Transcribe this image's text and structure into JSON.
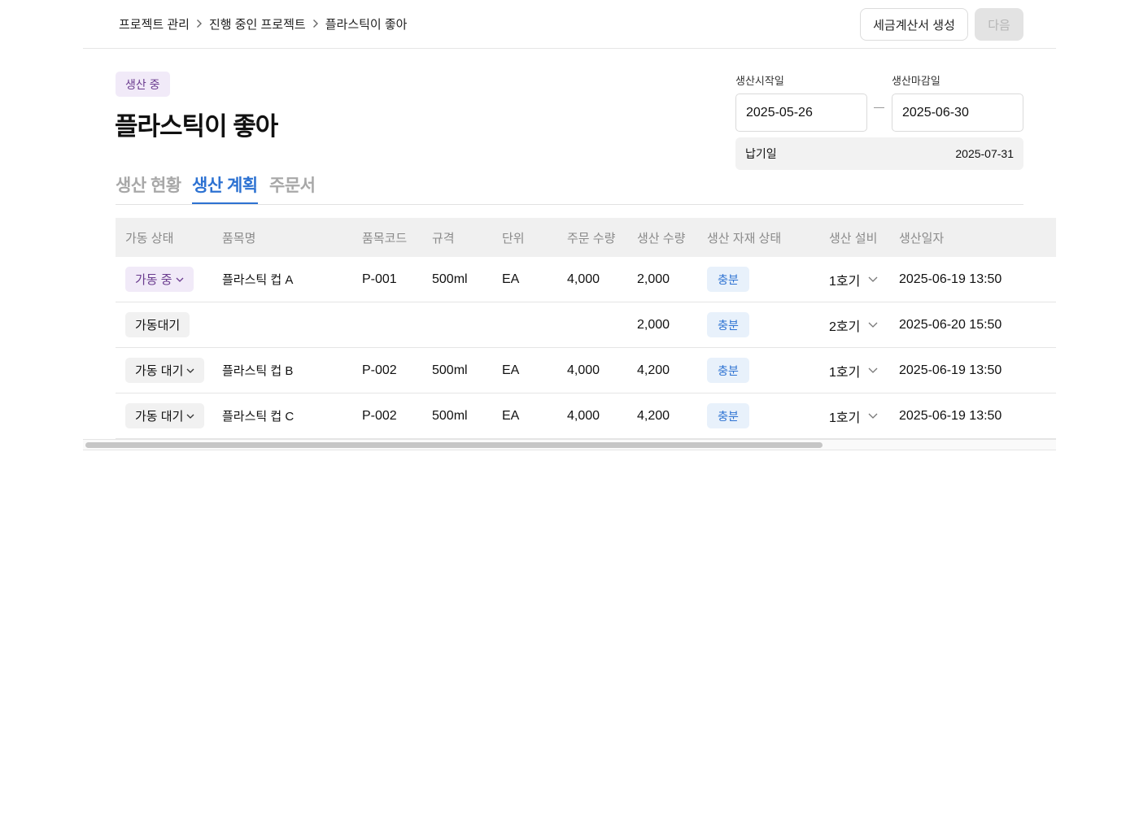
{
  "breadcrumb": [
    {
      "label": "프로젝트 관리"
    },
    {
      "label": "진행 중인 프로젝트"
    },
    {
      "label": "플라스틱이 좋아"
    }
  ],
  "header": {
    "invoice_button": "세금계산서 생성",
    "next_button": "다음"
  },
  "project": {
    "status": "생산 중",
    "title": "플라스틱이 좋아"
  },
  "tabs": [
    {
      "label": "생산 현황",
      "active": false
    },
    {
      "label": "생산 계획",
      "active": true
    },
    {
      "label": "주문서",
      "active": false
    }
  ],
  "dates": {
    "start_label": "생산시작일",
    "start_value": "2025-05-26",
    "end_label": "생산마감일",
    "end_value": "2025-06-30",
    "due_label": "납기일",
    "due_value": "2025-07-31"
  },
  "table": {
    "columns": [
      "가동 상태",
      "품목명",
      "품목코드",
      "규격",
      "단위",
      "주문 수량",
      "생산 수량",
      "생산 자재 상태",
      "생산 설비",
      "생산일자"
    ],
    "rows": [
      {
        "status": "가동 중",
        "status_type": "running",
        "has_dropdown": true,
        "name": "플라스틱 컵 A",
        "code": "P-001",
        "spec": "500ml",
        "unit": "EA",
        "order_qty": "4,000",
        "prod_qty": "2,000",
        "material": "충분",
        "equipment": "1호기",
        "date": "2025-06-19 13:50"
      },
      {
        "status": "가동대기",
        "status_type": "waiting",
        "has_dropdown": false,
        "name": "",
        "code": "",
        "spec": "",
        "unit": "",
        "order_qty": "",
        "prod_qty": "2,000",
        "material": "충분",
        "equipment": "2호기",
        "date": "2025-06-20 15:50"
      },
      {
        "status": "가동 대기",
        "status_type": "waiting",
        "has_dropdown": true,
        "name": "플라스틱 컵 B",
        "code": "P-002",
        "spec": "500ml",
        "unit": "EA",
        "order_qty": "4,000",
        "prod_qty": "4,200",
        "material": "충분",
        "equipment": "1호기",
        "date": "2025-06-19 13:50"
      },
      {
        "status": "가동 대기",
        "status_type": "waiting",
        "has_dropdown": true,
        "name": "플라스틱 컵 C",
        "code": "P-002",
        "spec": "500ml",
        "unit": "EA",
        "order_qty": "4,000",
        "prod_qty": "4,200",
        "material": "충분",
        "equipment": "1호기",
        "date": "2025-06-19 13:50"
      }
    ]
  },
  "colors": {
    "accent_blue": "#2d72d2",
    "status_purple": "#6b3c8f",
    "status_purple_bg": "#f1eaf8",
    "supply_bg": "#e8f1fb"
  },
  "icons": {
    "breadcrumb_separator": "chevron-right-icon",
    "dropdown": "chevron-down-icon"
  }
}
